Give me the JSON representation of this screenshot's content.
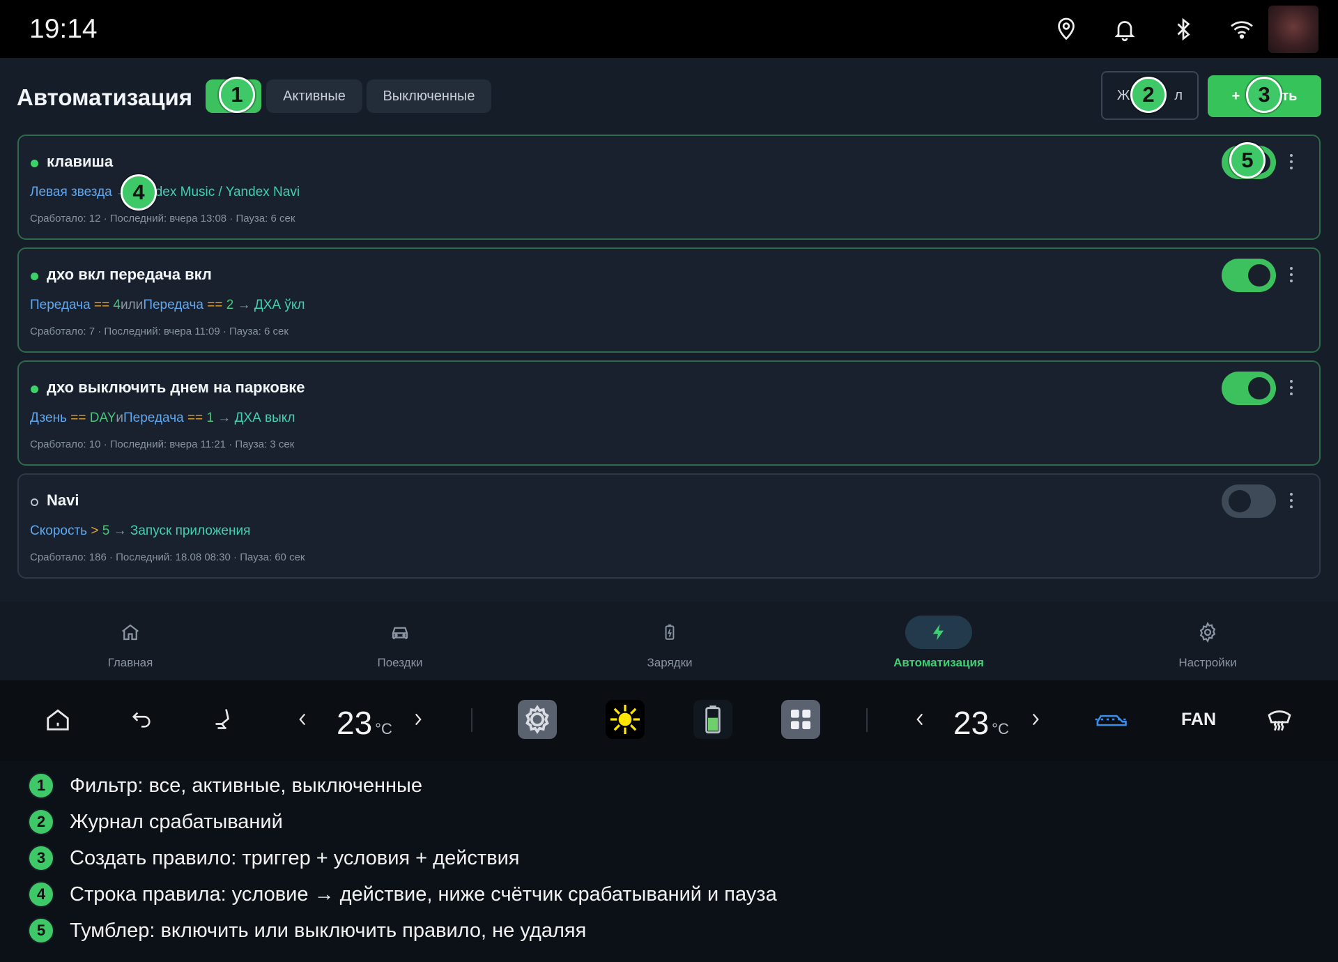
{
  "statusbar": {
    "time": "19:14",
    "icons": [
      "location-icon",
      "bell-icon",
      "bluetooth-icon",
      "wifi-icon"
    ]
  },
  "header": {
    "title": "Автоматизация",
    "filters": [
      {
        "label": "",
        "active": true
      },
      {
        "label": "Активные",
        "active": false
      },
      {
        "label": "Выключенные",
        "active": false
      }
    ],
    "journal_label": "Ж",
    "journal_label_tail": "л",
    "add_label": "+ ",
    "add_label_tail": "ть"
  },
  "rules": [
    {
      "name": "клавиша",
      "enabled": true,
      "line": [
        {
          "t": "Левая звезда",
          "k": "cond"
        },
        {
          "t": " → Ya",
          "k": "act"
        },
        {
          "t": "ndex Music / Yandex Navi",
          "k": "act"
        }
      ],
      "stats": "Сработало: 12 · Последний: вчера 13:08 · Пауза: 6 сек"
    },
    {
      "name": "дхо вкл передача вкл",
      "enabled": true,
      "line": [
        {
          "t": "Передача",
          "k": "cond"
        },
        {
          "t": " == ",
          "k": "op"
        },
        {
          "t": "4",
          "k": "val"
        },
        {
          "t": "или",
          "k": "join"
        },
        {
          "t": "Передача",
          "k": "cond"
        },
        {
          "t": " == ",
          "k": "op"
        },
        {
          "t": "2",
          "k": "val"
        },
        {
          "t": " → ",
          "k": "join"
        },
        {
          "t": "ДХА ўкл",
          "k": "act"
        }
      ],
      "stats": "Сработало: 7 · Последний: вчера 11:09 · Пауза: 6 сек"
    },
    {
      "name": "дхо выключить днем на парковке",
      "enabled": true,
      "line": [
        {
          "t": "Дзень",
          "k": "cond"
        },
        {
          "t": " == ",
          "k": "op"
        },
        {
          "t": "DAY",
          "k": "val"
        },
        {
          "t": "и",
          "k": "join"
        },
        {
          "t": "Передача",
          "k": "cond"
        },
        {
          "t": " == ",
          "k": "op"
        },
        {
          "t": "1",
          "k": "val"
        },
        {
          "t": " → ",
          "k": "join"
        },
        {
          "t": "ДХА выкл",
          "k": "act"
        }
      ],
      "stats": "Сработало: 10 · Последний: вчера 11:21 · Пауза: 3 сек"
    },
    {
      "name": "Navi",
      "enabled": false,
      "line": [
        {
          "t": "Скорость",
          "k": "cond"
        },
        {
          "t": " > ",
          "k": "op"
        },
        {
          "t": "5",
          "k": "val"
        },
        {
          "t": " → ",
          "k": "join"
        },
        {
          "t": "Запуск приложения",
          "k": "act"
        }
      ],
      "stats": "Сработало: 186 · Последний: 18.08 08:30 · Пауза: 60 сек"
    }
  ],
  "nav": [
    {
      "label": "Главная",
      "icon": "home-icon",
      "selected": false
    },
    {
      "label": "Поездки",
      "icon": "car-icon",
      "selected": false
    },
    {
      "label": "Зарядки",
      "icon": "battery-icon",
      "selected": false
    },
    {
      "label": "Автоматизация",
      "icon": "bolt-icon",
      "selected": true
    },
    {
      "label": "Настройки",
      "icon": "gear-icon",
      "selected": false
    }
  ],
  "climate": {
    "left_temp": "23",
    "right_temp": "23",
    "unit": "°C",
    "fan_label": "FAN"
  },
  "legend": [
    {
      "n": "1",
      "text": "Фильтр: все, активные, выключенные"
    },
    {
      "n": "2",
      "text": "Журнал срабатываний"
    },
    {
      "n": "3",
      "text": "Создать правило: триггер + условия + действия"
    },
    {
      "n": "4",
      "text": "Строка правила: условие → действие, ниже счётчик срабатываний и пауза"
    },
    {
      "n": "5",
      "text": "Тумблер: включить или выключить правило, не удаляя"
    }
  ],
  "markers": [
    "1",
    "2",
    "3",
    "4",
    "5"
  ],
  "colors": {
    "accent": "#3dc15e",
    "condition": "#5fa8f0",
    "operator": "#e0a23a",
    "action": "#43cfb3"
  }
}
